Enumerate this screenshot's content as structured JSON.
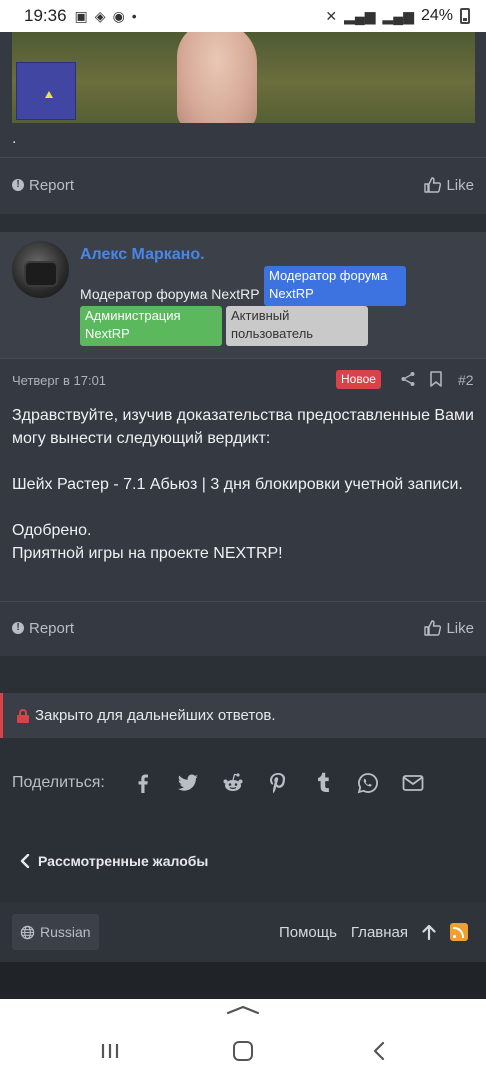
{
  "status_bar": {
    "time": "19:36",
    "battery": "24%"
  },
  "post1": {
    "text": ".",
    "report_label": "Report",
    "like_label": "Like"
  },
  "post2": {
    "username": "Алекс Маркано.",
    "user_title": "Модератор форума NextRP",
    "badges": {
      "moderator": "Модератор форума NextRP",
      "admin": "Администрация NextRP",
      "active": "Активный пользователь"
    },
    "date": "Четверг в 17:01",
    "new_label": "Новое",
    "number": "#2",
    "body": "Здравствуйте, изучив доказательства предоставленные Вами могу вынести следующий вердикт:\n\nШейх Растер - 7.1 Абьюз | 3 дня блокировки учетной записи.\n\nОдобрено.\nПриятной игры на проекте NEXTRP!",
    "report_label": "Report",
    "like_label": "Like"
  },
  "closed_notice": "Закрыто для дальнейших ответов.",
  "share": {
    "label": "Поделиться:",
    "icons": [
      "facebook-icon",
      "twitter-icon",
      "reddit-icon",
      "pinterest-icon",
      "tumblr-icon",
      "whatsapp-icon",
      "email-icon"
    ]
  },
  "back_link": "Рассмотренные жалобы",
  "footer": {
    "language": "Russian",
    "help": "Помощь",
    "home": "Главная"
  },
  "colors": {
    "page_bg": "#2b2f36",
    "post_bg": "#353a42",
    "username": "#4a86e8",
    "new_badge": "#d94248",
    "rss": "#f0a030"
  }
}
